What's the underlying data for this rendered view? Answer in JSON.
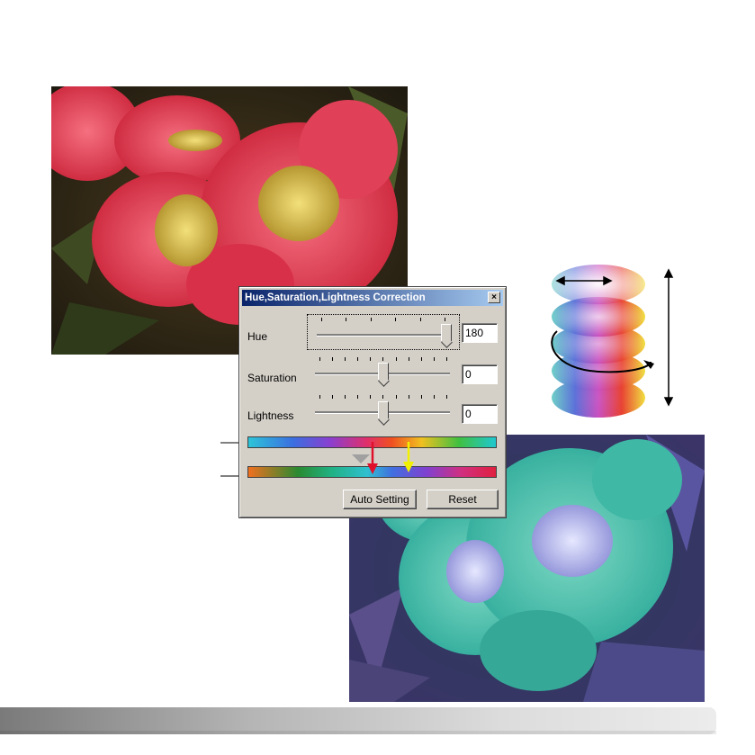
{
  "dialog": {
    "title": "Hue,Saturation,Lightness Correction",
    "close_glyph": "×",
    "hue": {
      "label": "Hue",
      "value": "180",
      "level": 1.0
    },
    "saturation": {
      "label": "Saturation",
      "value": "0",
      "level": 0.5
    },
    "lightness": {
      "label": "Lightness",
      "value": "0",
      "level": 0.5
    },
    "auto_setting_label": "Auto Setting",
    "reset_label": "Reset"
  },
  "colors": {
    "title_start": "#0a246a",
    "title_end": "#a6caf0",
    "dialog_bg": "#d4d0c8",
    "red_arrow": "#e0102a",
    "yellow_arrow": "#f2f200"
  },
  "illustration": {
    "icon": "color-wheel-stack-icon",
    "arrows": [
      "saturation-arrow-icon",
      "hue-rotation-arrow-icon",
      "lightness-arrow-icon"
    ]
  }
}
